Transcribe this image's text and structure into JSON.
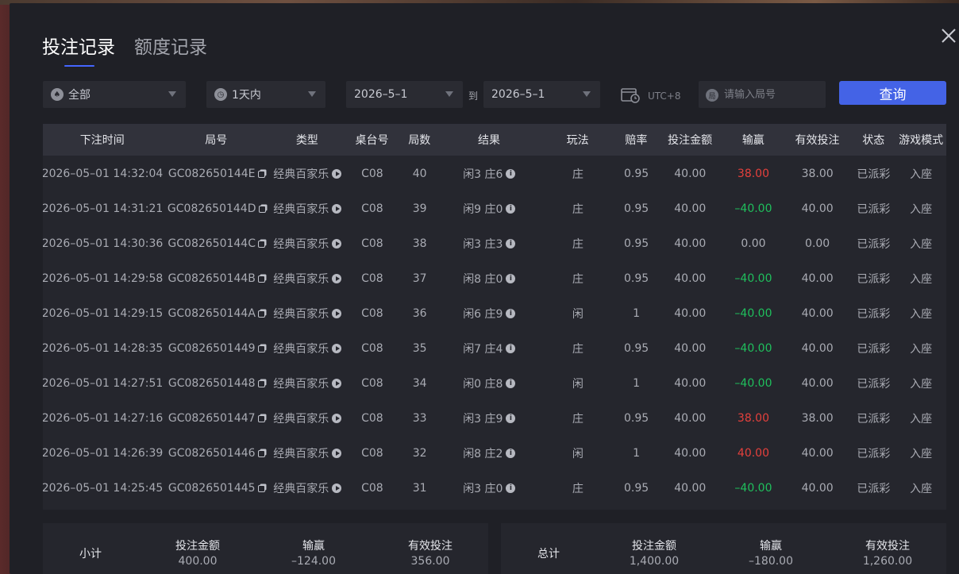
{
  "tabs": [
    {
      "label": "投注记录",
      "active": true
    },
    {
      "label": "额度记录",
      "active": false
    }
  ],
  "filters": {
    "game": "全部",
    "range": "1天内",
    "date_from": "2026–5–1",
    "to_label": "到",
    "date_to": "2026–5–1",
    "timezone": "UTC+8",
    "round_placeholder": "请输入局号",
    "query_label": "查询"
  },
  "table": {
    "headers": [
      "下注时间",
      "局号",
      "类型",
      "桌台号",
      "局数",
      "结果",
      "玩法",
      "赔率",
      "投注金额",
      "输赢",
      "有效投注",
      "状态",
      "游戏模式"
    ],
    "rows": [
      {
        "time": "2026–05–01 14:32:04",
        "round": "GC082650144E",
        "type": "经典百家乐",
        "table": "C08",
        "shoe": "40",
        "result": "闲3 庄6",
        "bet": "庄",
        "odds": "0.95",
        "amount": "40.00",
        "winloss": "38.00",
        "wl_sign": "pos",
        "valid": "38.00",
        "status": "已派彩",
        "mode": "入座"
      },
      {
        "time": "2026–05–01 14:31:21",
        "round": "GC082650144D",
        "type": "经典百家乐",
        "table": "C08",
        "shoe": "39",
        "result": "闲9 庄0",
        "bet": "庄",
        "odds": "0.95",
        "amount": "40.00",
        "winloss": "–40.00",
        "wl_sign": "neg",
        "valid": "40.00",
        "status": "已派彩",
        "mode": "入座"
      },
      {
        "time": "2026–05–01 14:30:36",
        "round": "GC082650144C",
        "type": "经典百家乐",
        "table": "C08",
        "shoe": "38",
        "result": "闲3 庄3",
        "bet": "庄",
        "odds": "0.95",
        "amount": "40.00",
        "winloss": "0.00",
        "wl_sign": "zero",
        "valid": "0.00",
        "status": "已派彩",
        "mode": "入座"
      },
      {
        "time": "2026–05–01 14:29:58",
        "round": "GC082650144B",
        "type": "经典百家乐",
        "table": "C08",
        "shoe": "37",
        "result": "闲8 庄0",
        "bet": "庄",
        "odds": "0.95",
        "amount": "40.00",
        "winloss": "–40.00",
        "wl_sign": "neg",
        "valid": "40.00",
        "status": "已派彩",
        "mode": "入座"
      },
      {
        "time": "2026–05–01 14:29:15",
        "round": "GC082650144A",
        "type": "经典百家乐",
        "table": "C08",
        "shoe": "36",
        "result": "闲6 庄9",
        "bet": "闲",
        "odds": "1",
        "amount": "40.00",
        "winloss": "–40.00",
        "wl_sign": "neg",
        "valid": "40.00",
        "status": "已派彩",
        "mode": "入座"
      },
      {
        "time": "2026–05–01 14:28:35",
        "round": "GC0826501449",
        "type": "经典百家乐",
        "table": "C08",
        "shoe": "35",
        "result": "闲7 庄4",
        "bet": "庄",
        "odds": "0.95",
        "amount": "40.00",
        "winloss": "–40.00",
        "wl_sign": "neg",
        "valid": "40.00",
        "status": "已派彩",
        "mode": "入座"
      },
      {
        "time": "2026–05–01 14:27:51",
        "round": "GC0826501448",
        "type": "经典百家乐",
        "table": "C08",
        "shoe": "34",
        "result": "闲0 庄8",
        "bet": "闲",
        "odds": "1",
        "amount": "40.00",
        "winloss": "–40.00",
        "wl_sign": "neg",
        "valid": "40.00",
        "status": "已派彩",
        "mode": "入座"
      },
      {
        "time": "2026–05–01 14:27:16",
        "round": "GC0826501447",
        "type": "经典百家乐",
        "table": "C08",
        "shoe": "33",
        "result": "闲3 庄9",
        "bet": "庄",
        "odds": "0.95",
        "amount": "40.00",
        "winloss": "38.00",
        "wl_sign": "pos",
        "valid": "38.00",
        "status": "已派彩",
        "mode": "入座"
      },
      {
        "time": "2026–05–01 14:26:39",
        "round": "GC0826501446",
        "type": "经典百家乐",
        "table": "C08",
        "shoe": "32",
        "result": "闲8 庄2",
        "bet": "闲",
        "odds": "1",
        "amount": "40.00",
        "winloss": "40.00",
        "wl_sign": "pos",
        "valid": "40.00",
        "status": "已派彩",
        "mode": "入座"
      },
      {
        "time": "2026–05–01 14:25:45",
        "round": "GC0826501445",
        "type": "经典百家乐",
        "table": "C08",
        "shoe": "31",
        "result": "闲3 庄0",
        "bet": "庄",
        "odds": "0.95",
        "amount": "40.00",
        "winloss": "–40.00",
        "wl_sign": "neg",
        "valid": "40.00",
        "status": "已派彩",
        "mode": "入座"
      }
    ]
  },
  "subtotal": {
    "label": "小计",
    "amount_label": "投注金额",
    "amount": "400.00",
    "winloss_label": "输赢",
    "winloss": "–124.00",
    "valid_label": "有效投注",
    "valid": "356.00"
  },
  "total": {
    "label": "总计",
    "amount_label": "投注金额",
    "amount": "1,400.00",
    "winloss_label": "输赢",
    "winloss": "–180.00",
    "valid_label": "有效投注",
    "valid": "1,260.00"
  },
  "colors": {
    "accent": "#4463e6",
    "win": "#e5403c",
    "loss": "#1fbf5c"
  }
}
